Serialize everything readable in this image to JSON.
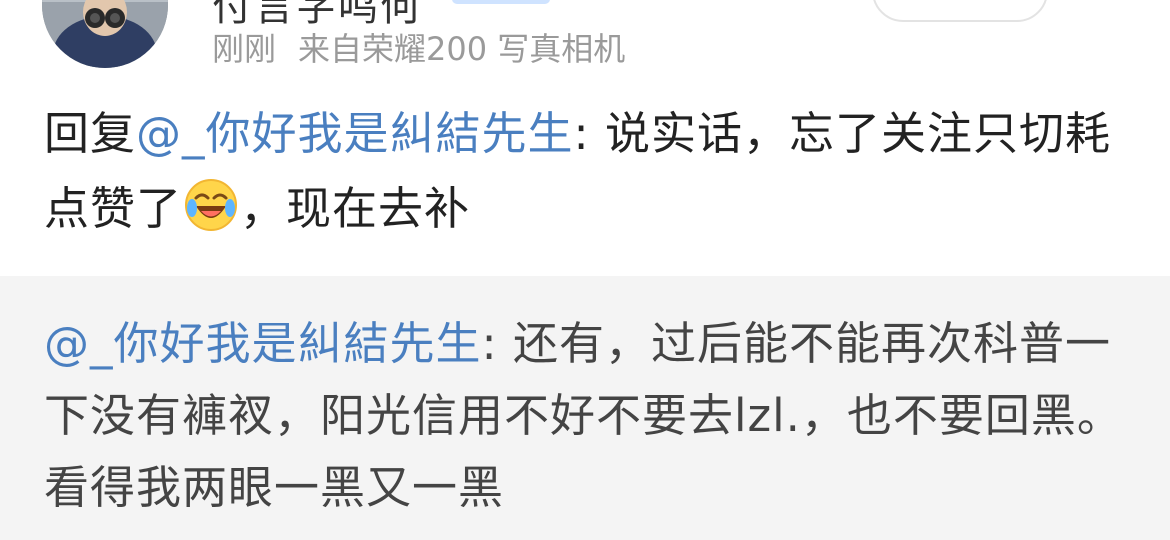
{
  "header": {
    "username": "付言字鸣何",
    "meta": {
      "time": "刚刚",
      "source": "来自荣耀200 写真相机"
    }
  },
  "reply": {
    "prefix": "回复",
    "mention": "@_你好我是糾結先生",
    "text_part1": ": 说实话，忘了关注只切耗点赞了",
    "emoji": "laughing-crying-emoji",
    "text_part2": "，现在去补"
  },
  "quote": {
    "mention": "@_你好我是糾結先生",
    "text": ": 还有，过后能不能再次科普一下没有褲衩，阳光信用不好不要去lzl.，也不要回黑。看得我两眼一黑又一黑"
  },
  "colors": {
    "mention": "#4a7fc0",
    "body_text": "#222222",
    "meta_text": "#9a9a9a",
    "quote_bg": "#f4f4f4"
  }
}
